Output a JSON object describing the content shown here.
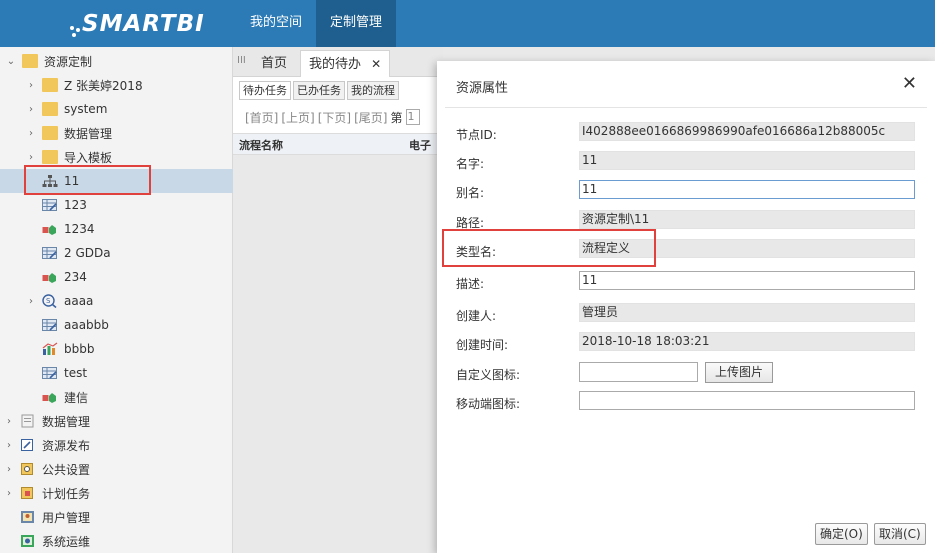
{
  "header": {
    "logo_text": "SMARTBI",
    "nav": [
      "我的空间",
      "定制管理"
    ],
    "active_nav": "定制管理",
    "color": "#2c7bb6"
  },
  "tree": {
    "items": [
      {
        "label": "资源定制",
        "icon": "folder-icon",
        "expanded": true
      },
      {
        "label": "Z 张美婷2018",
        "icon": "folder-icon"
      },
      {
        "label": "system",
        "icon": "folder-icon"
      },
      {
        "label": "数据管理",
        "icon": "folder-icon"
      },
      {
        "label": "导入模板",
        "icon": "folder-icon"
      },
      {
        "label": "11",
        "icon": "flowchart-icon",
        "selected": true
      },
      {
        "label": "123",
        "icon": "report-icon"
      },
      {
        "label": "1234",
        "icon": "cube-icon"
      },
      {
        "label": "2 GDDa",
        "icon": "report-icon"
      },
      {
        "label": "234",
        "icon": "cube-icon"
      },
      {
        "label": "aaaa",
        "icon": "query-icon"
      },
      {
        "label": "aaabbb",
        "icon": "report-icon"
      },
      {
        "label": "bbbb",
        "icon": "chart-icon"
      },
      {
        "label": "test",
        "icon": "report-icon"
      },
      {
        "label": "建信",
        "icon": "cube-icon"
      },
      {
        "label": "数据管理",
        "icon": "datamgmt-icon"
      },
      {
        "label": "资源发布",
        "icon": "publish-icon"
      },
      {
        "label": "公共设置",
        "icon": "settings-icon"
      },
      {
        "label": "计划任务",
        "icon": "schedule-icon"
      },
      {
        "label": "用户管理",
        "icon": "user-icon"
      },
      {
        "label": "系统运维",
        "icon": "ops-icon"
      }
    ]
  },
  "middle": {
    "menu_glyph": "III",
    "tabs": [
      "首页",
      "我的待办"
    ],
    "close_glyph": "✕",
    "subtabs": [
      "待办任务",
      "已办任务",
      "我的流程"
    ],
    "pager": [
      "[首页]",
      "[上页]",
      "[下页]",
      "[尾页]",
      "第",
      "1"
    ],
    "columns": [
      "流程名称",
      "电子"
    ]
  },
  "dialog": {
    "title": "资源属性",
    "close": "✕",
    "fields": [
      {
        "label": "节点ID:",
        "value": "I402888ee0166869986990afe016686a12b88005c"
      },
      {
        "label": "名字:",
        "value": "11"
      },
      {
        "label": "别名:",
        "value": "11"
      },
      {
        "label": "路径:",
        "value": "资源定制\\11"
      },
      {
        "label": "类型名:",
        "value": "流程定义"
      },
      {
        "label": "描述:",
        "value": "11"
      },
      {
        "label": "创建人:",
        "value": "管理员"
      },
      {
        "label": "创建时间:",
        "value": "2018-10-18 18:03:21"
      },
      {
        "label": "自定义图标:",
        "value": ""
      },
      {
        "label": "移动端图标:",
        "value": ""
      }
    ],
    "upload_label": "上传图片",
    "ok_label": "确定(O)",
    "cancel_label": "取消(C)"
  }
}
